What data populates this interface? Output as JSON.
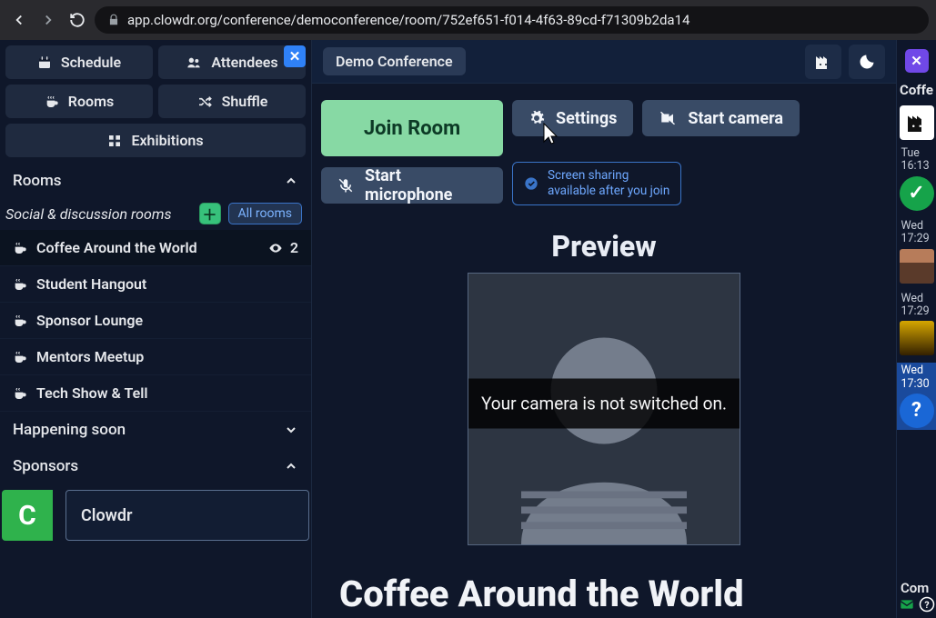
{
  "browser": {
    "url": "app.clowdr.org/conference/democonference/room/752ef651-f014-4f63-89cd-f71309b2da14"
  },
  "sidebar": {
    "nav": {
      "schedule": "Schedule",
      "attendees": "Attendees",
      "rooms": "Rooms",
      "shuffle": "Shuffle",
      "exhibitions": "Exhibitions"
    },
    "rooms_header": "Rooms",
    "rooms_subheader": "Social & discussion rooms",
    "all_rooms_label": "All rooms",
    "rooms": [
      {
        "label": "Coffee Around the World",
        "viewers": "2",
        "active": true
      },
      {
        "label": "Student Hangout"
      },
      {
        "label": "Sponsor Lounge"
      },
      {
        "label": "Mentors Meetup"
      },
      {
        "label": "Tech Show & Tell"
      }
    ],
    "happening_soon": "Happening soon",
    "sponsors_header": "Sponsors",
    "sponsor": {
      "initial": "C",
      "name": "Clowdr"
    }
  },
  "topbar": {
    "conference": "Demo Conference"
  },
  "controls": {
    "join": "Join Room",
    "settings": "Settings",
    "start_camera": "Start camera",
    "start_microphone": "Start microphone",
    "screen_note_l1": "Screen sharing",
    "screen_note_l2": "available after you join"
  },
  "preview": {
    "title": "Preview",
    "overlay": "Your camera is not switched on."
  },
  "room_heading": "Coffee Around the World",
  "rail": {
    "label": "Coffe",
    "entries": [
      {
        "day": "Tue",
        "time": "16:13",
        "kind": "check"
      },
      {
        "day": "Wed",
        "time": "17:29",
        "kind": "avatar1"
      },
      {
        "day": "Wed",
        "time": "17:29",
        "kind": "avatar2"
      },
      {
        "day": "Wed",
        "time": "17:30",
        "kind": "quest",
        "active": true
      }
    ],
    "compose": "Com"
  }
}
